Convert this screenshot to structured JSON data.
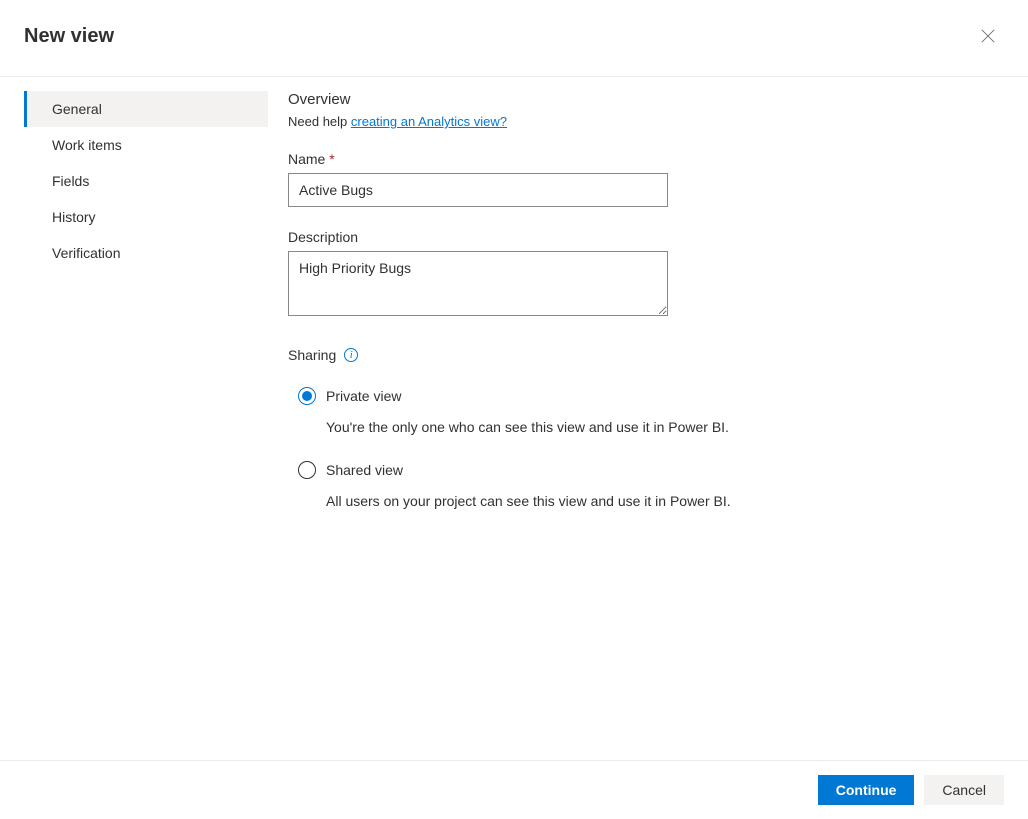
{
  "header": {
    "title": "New view"
  },
  "sidebar": {
    "items": [
      {
        "label": "General",
        "active": true
      },
      {
        "label": "Work items",
        "active": false
      },
      {
        "label": "Fields",
        "active": false
      },
      {
        "label": "History",
        "active": false
      },
      {
        "label": "Verification",
        "active": false
      }
    ]
  },
  "content": {
    "section_title": "Overview",
    "help_prefix": "Need help ",
    "help_link": "creating an Analytics view?",
    "name_label": "Name",
    "name_required": "*",
    "name_value": "Active Bugs",
    "description_label": "Description",
    "description_value": "High Priority Bugs",
    "sharing_label": "Sharing",
    "radio": [
      {
        "label": "Private view",
        "desc": "You're the only one who can see this view and use it in Power BI.",
        "selected": true
      },
      {
        "label": "Shared view",
        "desc": "All users on your project can see this view and use it in Power BI.",
        "selected": false
      }
    ]
  },
  "footer": {
    "continue": "Continue",
    "cancel": "Cancel"
  }
}
